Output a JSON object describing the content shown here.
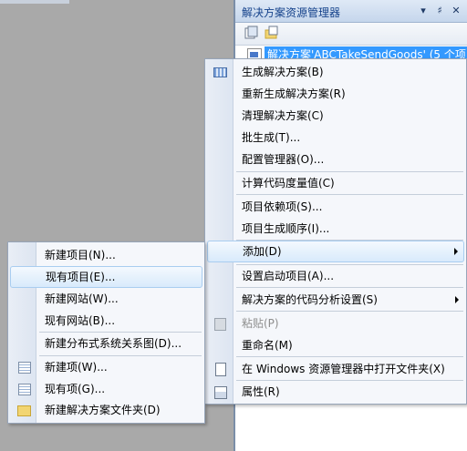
{
  "solution_explorer": {
    "title": "解决方案资源管理器",
    "pin_glyph": "▾",
    "pin2_glyph": "♯",
    "close_glyph": "✕",
    "tree_item": "解决方案'ABCTakeSendGoods' (5 个项"
  },
  "main_menu": {
    "items": [
      {
        "label": "生成解决方案(B)",
        "icon": "build-icon"
      },
      {
        "label": "重新生成解决方案(R)"
      },
      {
        "label": "清理解决方案(C)"
      },
      {
        "label": "批生成(T)..."
      },
      {
        "label": "配置管理器(O)..."
      },
      {
        "label": "计算代码度量值(C)"
      },
      {
        "label": "项目依赖项(S)..."
      },
      {
        "label": "项目生成顺序(I)..."
      },
      {
        "label": "添加(D)",
        "submenu": true
      },
      {
        "label": "设置启动项目(A)..."
      },
      {
        "label": "解决方案的代码分析设置(S)",
        "submenu": true
      },
      {
        "label": "粘贴(P)",
        "disabled": true,
        "icon": "paste-icon"
      },
      {
        "label": "重命名(M)"
      },
      {
        "label": "在 Windows 资源管理器中打开文件夹(X)",
        "icon": "open-folder-icon"
      },
      {
        "label": "属性(R)",
        "icon": "properties-icon"
      }
    ]
  },
  "add_submenu": {
    "items": [
      {
        "label": "新建项目(N)..."
      },
      {
        "label": "现有项目(E)..."
      },
      {
        "label": "新建网站(W)..."
      },
      {
        "label": "现有网站(B)..."
      },
      {
        "label": "新建分布式系统关系图(D)..."
      },
      {
        "label": "新建项(W)...",
        "icon": "new-item-icon"
      },
      {
        "label": "现有项(G)...",
        "icon": "existing-item-icon"
      },
      {
        "label": "新建解决方案文件夹(D)",
        "icon": "solution-folder-icon"
      }
    ]
  }
}
